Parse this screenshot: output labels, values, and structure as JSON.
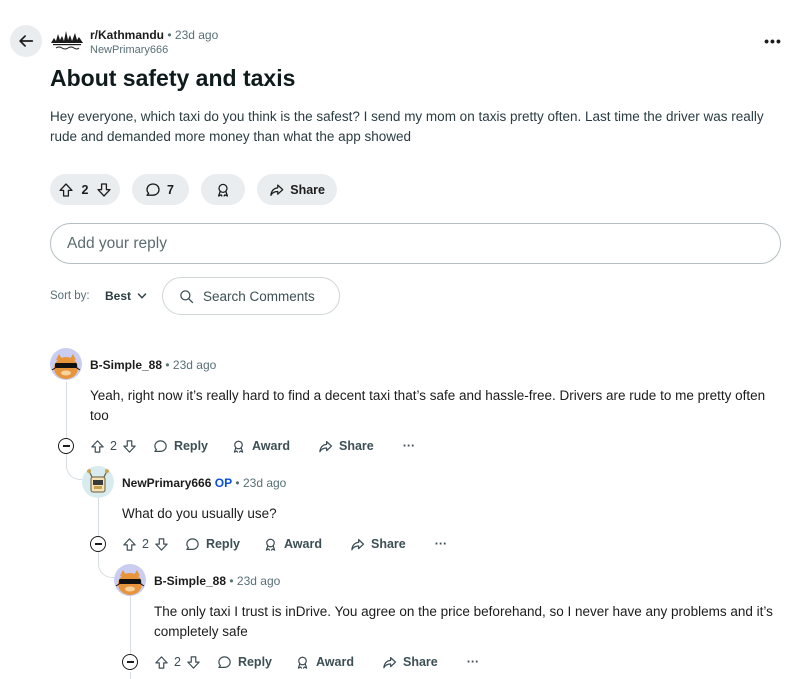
{
  "header": {
    "back_icon": "arrow-left-icon",
    "subreddit": "r/Kathmandu",
    "separator": "•",
    "time_ago": "23d ago",
    "author": "NewPrimary666",
    "more_label": "•••"
  },
  "post": {
    "title": "About safety and taxis",
    "body": "Hey everyone, which taxi do you think is the safest? I send my mom on taxis pretty often. Last time the driver was really rude and demanded more money than what the app showed",
    "votes": "2",
    "comments": "7",
    "share_label": "Share"
  },
  "reply_box": {
    "placeholder": "Add your reply"
  },
  "sort": {
    "label": "Sort by:",
    "value": "Best"
  },
  "search": {
    "placeholder": "Search Comments"
  },
  "comments": [
    {
      "user": "B-Simple_88",
      "op_tag": "",
      "time_ago": "23d ago",
      "body": "Yeah, right now it’s really hard to find a decent taxi that’s safe and hassle-free. Drivers are rude to me pretty often too",
      "votes": "2",
      "reply_label": "Reply",
      "award_label": "Award",
      "share_label": "Share",
      "more_label": "···"
    },
    {
      "user": "NewPrimary666",
      "op_tag": "OP",
      "time_ago": "23d ago",
      "body": "What do you usually use?",
      "votes": "2",
      "reply_label": "Reply",
      "award_label": "Award",
      "share_label": "Share",
      "more_label": "···"
    },
    {
      "user": "B-Simple_88",
      "op_tag": "",
      "time_ago": "23d ago",
      "body": "The only taxi I trust is inDrive. You agree on the price beforehand, so I never have any problems and it’s completely safe",
      "votes": "2",
      "reply_label": "Reply",
      "award_label": "Award",
      "share_label": "Share",
      "more_label": "···"
    }
  ],
  "colors": {
    "accent_op": "#0a4fd6",
    "pill_bg": "#eaedef",
    "text_muted": "#576f76"
  }
}
